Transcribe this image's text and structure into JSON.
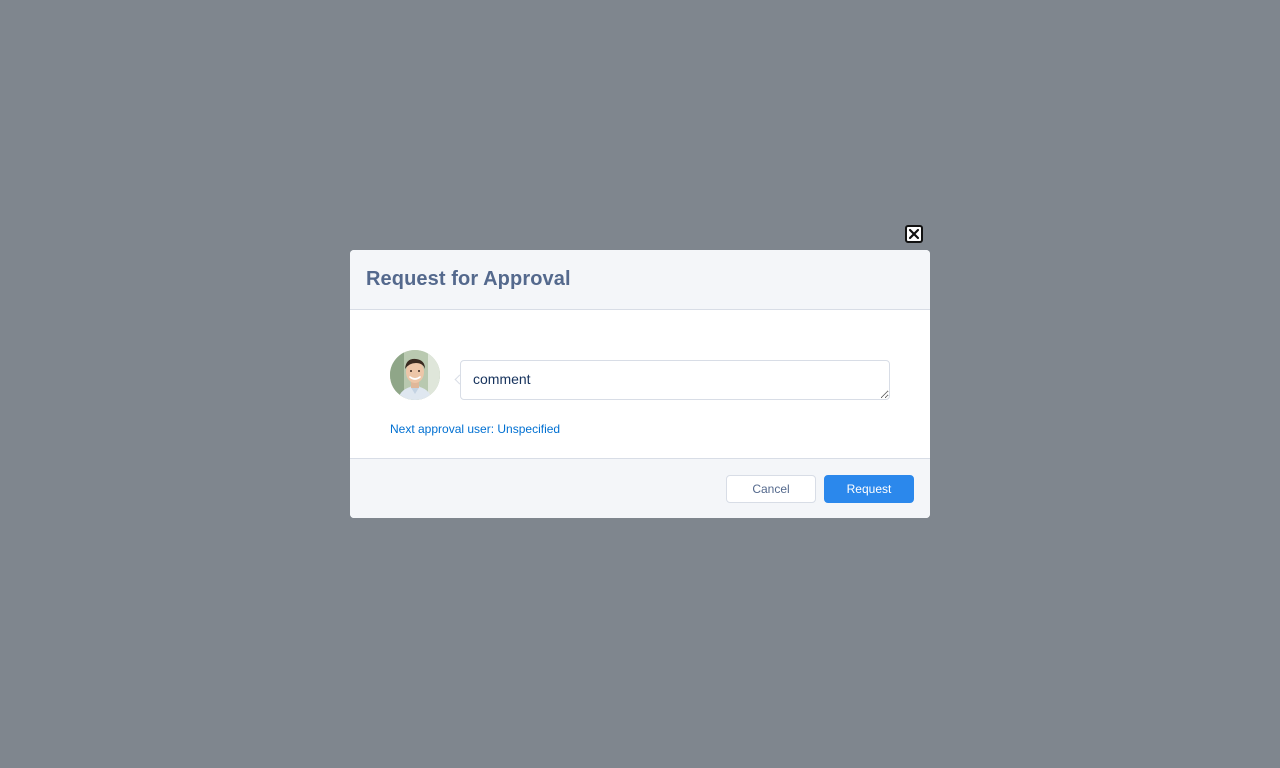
{
  "modal": {
    "title": "Request for Approval",
    "comment": {
      "placeholder": "comment",
      "value": ""
    },
    "next_approval_text": "Next approval user: Unspecified",
    "footer": {
      "cancel_label": "Cancel",
      "request_label": "Request"
    }
  },
  "icons": {
    "close": "close-icon",
    "avatar": "user-avatar"
  },
  "colors": {
    "overlay": "#7f868e",
    "title": "#54698d",
    "link": "#0070d2",
    "primary_button": "#2b88ec",
    "header_footer_bg": "#f4f6f9"
  }
}
